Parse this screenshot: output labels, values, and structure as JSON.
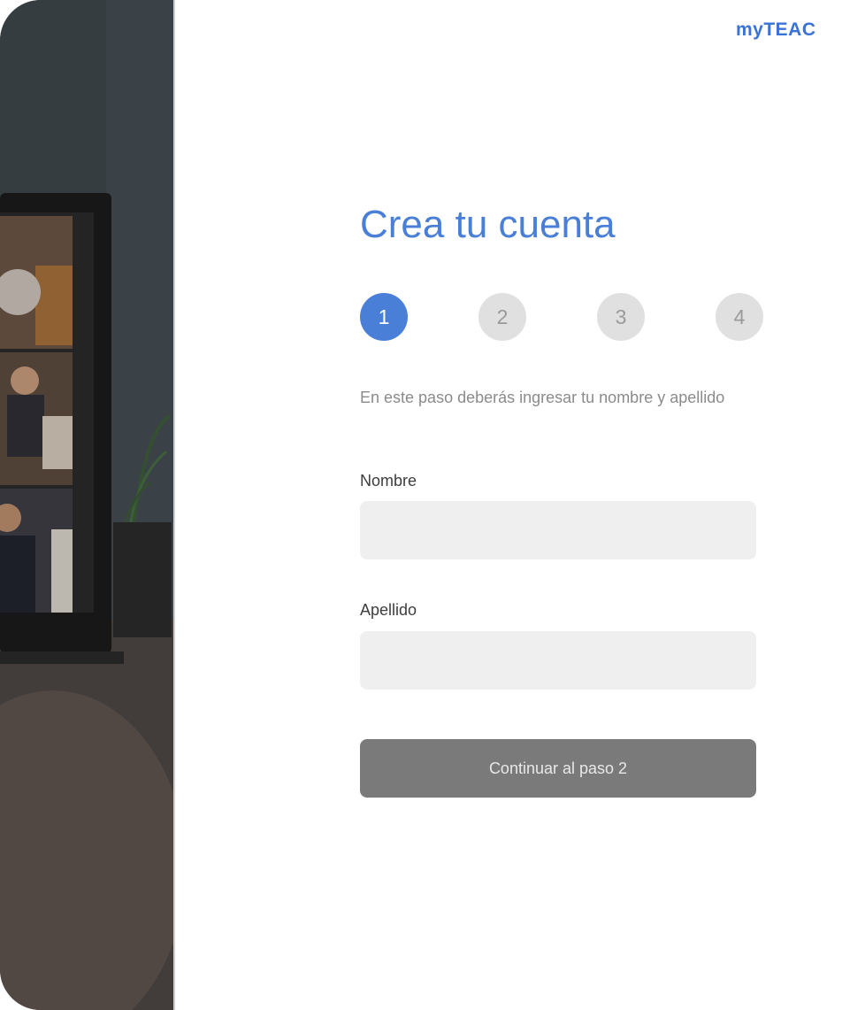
{
  "brand": {
    "name": "myTEAC"
  },
  "form": {
    "title": "Crea tu cuenta",
    "steps": [
      "1",
      "2",
      "3",
      "4"
    ],
    "active_step": 1,
    "description": "En este paso deberás ingresar tu nombre y apellido",
    "fields": {
      "first_name": {
        "label": "Nombre",
        "value": "",
        "placeholder": ""
      },
      "last_name": {
        "label": "Apellido",
        "value": "",
        "placeholder": ""
      }
    },
    "submit_label": "Continuar al paso 2"
  },
  "colors": {
    "accent": "#4a7fd8",
    "brand": "#3a72d6",
    "inactive_step": "#e0e0e0",
    "input_bg": "#efefef",
    "button_bg": "#7a7a7a"
  },
  "hero": {
    "image": "photo of a laptop showing a video call with several participants, plant in background"
  }
}
